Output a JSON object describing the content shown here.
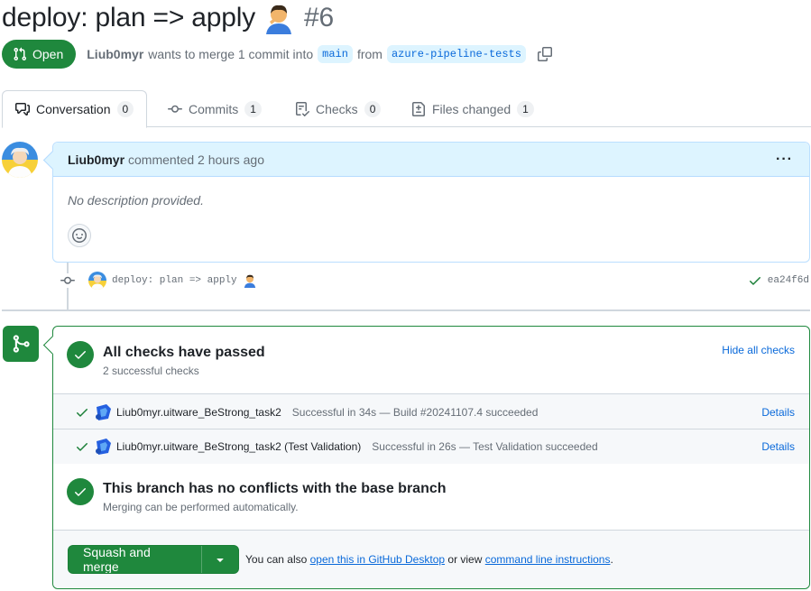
{
  "pr": {
    "title": "deploy: plan => apply",
    "number": "#6",
    "state": "Open",
    "author": "Liub0myr",
    "merge_text": "wants to merge 1 commit into",
    "base_branch": "main",
    "from_text": "from",
    "head_branch": "azure-pipeline-tests"
  },
  "tabs": [
    {
      "label": "Conversation",
      "count": "0",
      "icon": "comment-discussion-icon"
    },
    {
      "label": "Commits",
      "count": "1",
      "icon": "git-commit-icon"
    },
    {
      "label": "Checks",
      "count": "0",
      "icon": "checklist-icon"
    },
    {
      "label": "Files changed",
      "count": "1",
      "icon": "file-diff-icon"
    }
  ],
  "comment": {
    "author": "Liub0myr",
    "meta": "commented 2 hours ago",
    "body": "No description provided."
  },
  "commit": {
    "message": "deploy: plan => apply",
    "sha": "ea24f6d"
  },
  "checks": {
    "title": "All checks have passed",
    "subtitle": "2 successful checks",
    "hide_label": "Hide all checks",
    "items": [
      {
        "name": "Liub0myr.uitware_BeStrong_task2",
        "description": "Successful in 34s — Build #20241107.4 succeeded",
        "details": "Details"
      },
      {
        "name": "Liub0myr.uitware_BeStrong_task2 (Test Validation)",
        "description": "Successful in 26s — Test Validation succeeded",
        "details": "Details"
      }
    ]
  },
  "conflicts": {
    "title": "This branch has no conflicts with the base branch",
    "subtitle": "Merging can be performed automatically."
  },
  "merge": {
    "button_label": "Squash and merge",
    "prefix": "You can also",
    "desktop_link": "open this in GitHub Desktop",
    "or_view": "or view",
    "cli_link": "command line instructions",
    "suffix": "."
  },
  "colors": {
    "open_green": "#1f883d",
    "link_blue": "#0969da",
    "header_blue": "#ddf4ff"
  }
}
